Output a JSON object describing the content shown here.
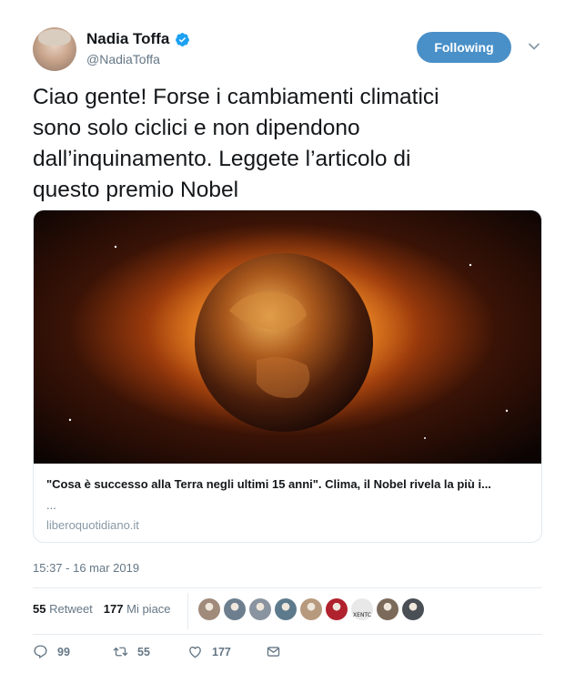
{
  "author": {
    "name": "Nadia Toffa",
    "handle": "@NadiaToffa"
  },
  "follow_button": {
    "label": "Following"
  },
  "tweet": {
    "text": "Ciao gente! Forse i cambiamenti  climatici\nsono solo ciclici e non dipendono\ndall’inquinamento. Leggete l’articolo di\nquesto premio Nobel"
  },
  "card": {
    "title": "\"Cosa è successo alla Terra negli ultimi 15 anni\". Clima, il Nobel rivela la più i...",
    "description": "...",
    "domain": "liberoquotidiano.it"
  },
  "timestamp": "15:37 - 16 mar 2019",
  "stats": {
    "retweets": {
      "count": "55",
      "label": "Retweet"
    },
    "likes": {
      "count": "177",
      "label": "Mi piace"
    }
  },
  "likers": [
    {
      "icon": "user-avatar",
      "color": "#a08a7a"
    },
    {
      "icon": "user-avatar",
      "color": "#6d7f8f"
    },
    {
      "icon": "user-avatar",
      "color": "#8a94a0"
    },
    {
      "icon": "user-avatar",
      "color": "#5d7a8c"
    },
    {
      "icon": "user-avatar",
      "color": "#b79a7e"
    },
    {
      "icon": "rose-avatar",
      "color": "#b0222e"
    },
    {
      "icon": "logo-avatar",
      "color": "#e8e8e8",
      "text": "XENTC"
    },
    {
      "icon": "user-avatar",
      "color": "#7b6a5a"
    },
    {
      "icon": "user-avatar",
      "color": "#4a4f55"
    }
  ],
  "actions": {
    "reply_count": "99",
    "retweet_count": "55",
    "like_count": "177"
  },
  "colors": {
    "accent": "#1da1f2",
    "follow_bg": "#4a90c8",
    "muted": "#657786"
  }
}
